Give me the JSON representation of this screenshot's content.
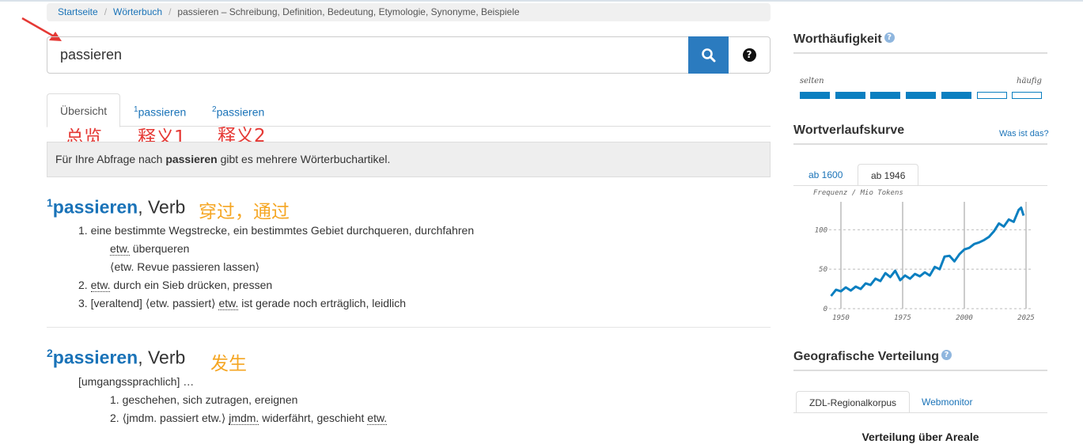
{
  "breadcrumb": {
    "home": "Startseite",
    "dictionary": "Wörterbuch",
    "current": "passieren – Schreibung, Definition, Bedeutung, Etymologie, Synonyme, Beispiele"
  },
  "search": {
    "value": "passieren",
    "search_icon": "search-icon",
    "help_icon": "question-circle-icon"
  },
  "tabs": [
    {
      "label": "Übersicht",
      "sup": ""
    },
    {
      "label": "passieren",
      "sup": "1"
    },
    {
      "label": "passieren",
      "sup": "2"
    }
  ],
  "annotations": {
    "overview": "总览",
    "def1": "释义1",
    "def2": "释义2",
    "entry1": "穿过，通过",
    "entry2": "发生"
  },
  "notice": {
    "before": "Für Ihre Abfrage nach ",
    "term": "passieren",
    "after": " gibt es mehrere Wörterbuchartikel."
  },
  "entry1": {
    "sup": "1",
    "lemma": "passieren",
    "pos": ", Verb",
    "senses": {
      "s1": "1. eine bestimmte Wegstrecke, ein bestimmtes Gebiet durchqueren, durchfahren",
      "s1a_abbr": "etw.",
      "s1a_text": " überqueren",
      "s1b": "⟨etw. Revue passieren lassen⟩",
      "s2_pre": "2. ",
      "s2_abbr": "etw.",
      "s2_text": " durch ein Sieb drücken, pressen",
      "s3_pre": "3. [veraltend] ⟨etw. passiert⟩ ",
      "s3_abbr": "etw.",
      "s3_text": " ist gerade noch erträglich, leidlich"
    }
  },
  "entry2": {
    "sup": "2",
    "lemma": "passieren",
    "pos": ", Verb",
    "register": "[umgangssprachlich] …",
    "senses": {
      "s1": "1. geschehen, sich zutragen, ereignen",
      "s2_pre": "2. ⟨jmdm. passiert etw.⟩ ",
      "s2_abbr1": "jmdm.",
      "s2_mid": " widerfährt, geschieht ",
      "s2_abbr2": "etw."
    }
  },
  "sidebar": {
    "frequency": {
      "title": "Worthäufigkeit",
      "low_label": "selten",
      "high_label": "häufig",
      "level": 5,
      "max": 7,
      "color": "#0b7fc0"
    },
    "curve": {
      "title": "Wortverlaufskurve",
      "help_link": "Was ist das?",
      "tabs": [
        "ab 1600",
        "ab 1946"
      ],
      "active_tab": "ab 1946"
    },
    "geo": {
      "title": "Geografische Verteilung",
      "tabs": [
        "ZDL-Regionalkorpus",
        "Webmonitor"
      ],
      "subtitle": "Verteilung über Areale"
    }
  },
  "chart_data": {
    "type": "line",
    "title": "",
    "ylabel": "Frequenz / Mio Tokens",
    "xlabel": "",
    "xlim": [
      1946,
      2025
    ],
    "ylim": [
      0,
      130
    ],
    "x_ticks": [
      1950,
      1975,
      2000,
      2025
    ],
    "y_ticks": [
      0,
      50,
      100
    ],
    "grid": "dashed-horizontal",
    "color": "#0b7fc0",
    "series": [
      {
        "x": [
          1946,
          1948,
          1950,
          1952,
          1954,
          1956,
          1958,
          1960,
          1962,
          1964,
          1966,
          1968,
          1970,
          1972,
          1974,
          1976,
          1978,
          1980,
          1982,
          1984,
          1986,
          1988,
          1990,
          1992,
          1994,
          1996,
          1998,
          2000,
          2002,
          2004,
          2006,
          2008,
          2010,
          2012,
          2014,
          2016,
          2018,
          2020,
          2022,
          2023,
          2024
        ],
        "y": [
          16,
          24,
          22,
          27,
          23,
          28,
          25,
          32,
          30,
          38,
          35,
          45,
          40,
          48,
          36,
          42,
          38,
          44,
          41,
          46,
          42,
          53,
          50,
          66,
          67,
          60,
          69,
          75,
          77,
          82,
          84,
          87,
          91,
          98,
          108,
          104,
          113,
          110,
          125,
          128,
          118
        ]
      }
    ]
  }
}
